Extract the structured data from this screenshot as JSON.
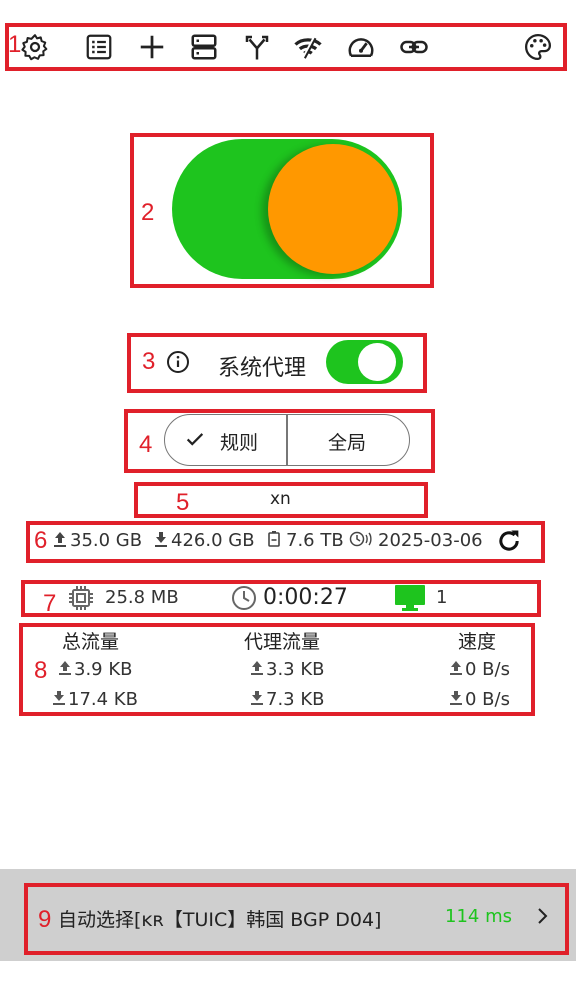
{
  "toolbar": {
    "icons": [
      "settings-icon",
      "list-icon",
      "add-icon",
      "server-icon",
      "merge-icon",
      "network-icon",
      "speedometer-icon",
      "link-icon",
      "palette-icon"
    ]
  },
  "annotations": {
    "n1": "1",
    "n2": "2",
    "n3": "3",
    "n4": "4",
    "n5": "5",
    "n6": "6",
    "n7": "7",
    "n8": "8",
    "n9": "9"
  },
  "colors": {
    "accent_green": "#1ec41e",
    "knob_orange": "#ff9800",
    "annotation_red": "#e0202a"
  },
  "main_toggle": {
    "on": true
  },
  "system_proxy": {
    "label": "系统代理",
    "enabled": true
  },
  "mode": {
    "rule_label": "规则",
    "global_label": "全局",
    "selected": "规则"
  },
  "profile": {
    "name": "xn"
  },
  "subscription": {
    "upload": "35.0 GB",
    "download": "426.0 GB",
    "total": "7.6 TB",
    "expire": "2025-03-06"
  },
  "runtime": {
    "memory": "25.8 MB",
    "uptime": "0:00:27",
    "connections": "1"
  },
  "traffic": {
    "headers": [
      "总流量",
      "代理流量",
      "速度"
    ],
    "total_up": "3.9 KB",
    "total_down": "17.4 KB",
    "proxy_up": "3.3 KB",
    "proxy_down": "7.3 KB",
    "speed_up": "0 B/s",
    "speed_down": "0 B/s"
  },
  "node": {
    "name": "自动选择[ᴋʀ【TUIC】韩国 BGP D04]",
    "latency": "114 ms"
  }
}
